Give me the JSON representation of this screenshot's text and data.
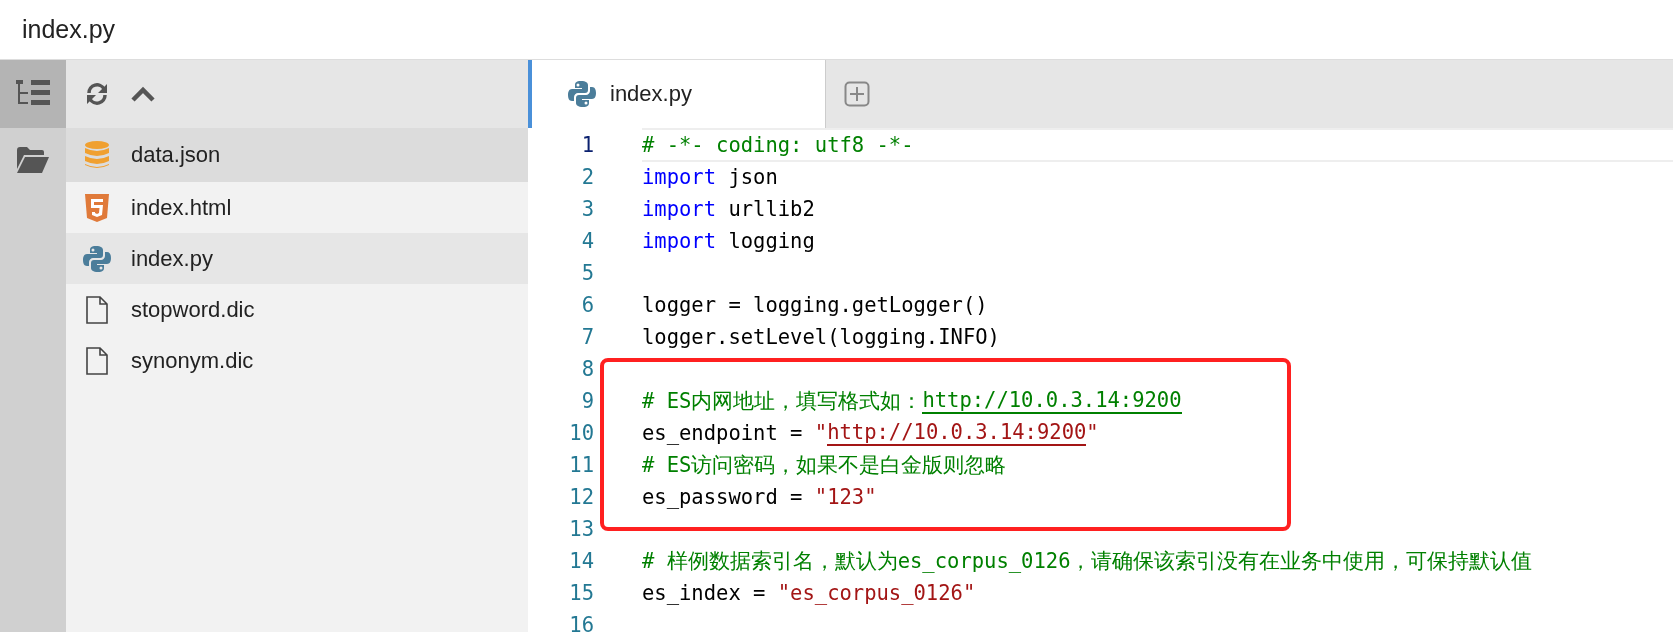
{
  "window": {
    "title": "index.py"
  },
  "sidebar": {
    "items": [
      {
        "label": "data.json",
        "kind": "database",
        "selected": true,
        "open": false
      },
      {
        "label": "index.html",
        "kind": "html5",
        "selected": false,
        "open": false
      },
      {
        "label": "index.py",
        "kind": "python",
        "selected": false,
        "open": true
      },
      {
        "label": "stopword.dic",
        "kind": "file",
        "selected": false,
        "open": false
      },
      {
        "label": "synonym.dic",
        "kind": "file",
        "selected": false,
        "open": false
      }
    ]
  },
  "tabs": [
    {
      "label": "index.py",
      "selected": true
    }
  ],
  "editor": {
    "lines": [
      {
        "number": "1",
        "active": true,
        "tokens": [
          {
            "kind": "comment",
            "text": "# -*- coding: utf8 -*-"
          }
        ]
      },
      {
        "number": "2",
        "active": false,
        "tokens": [
          {
            "kind": "keyword",
            "text": "import"
          },
          {
            "kind": "plain",
            "text": " json"
          }
        ]
      },
      {
        "number": "3",
        "active": false,
        "tokens": [
          {
            "kind": "keyword",
            "text": "import"
          },
          {
            "kind": "plain",
            "text": " urllib2"
          }
        ]
      },
      {
        "number": "4",
        "active": false,
        "tokens": [
          {
            "kind": "keyword",
            "text": "import"
          },
          {
            "kind": "plain",
            "text": " logging"
          }
        ]
      },
      {
        "number": "5",
        "active": false
      },
      {
        "number": "6",
        "active": false,
        "tokens": [
          {
            "kind": "plain",
            "text": "logger = logging.getLogger()"
          }
        ]
      },
      {
        "number": "7",
        "active": false,
        "tokens": [
          {
            "kind": "plain",
            "text": "logger.setLevel(logging.INFO)"
          }
        ]
      },
      {
        "number": "8",
        "active": false
      },
      {
        "number": "9",
        "active": false,
        "tokens": [
          {
            "kind": "comment",
            "text": "# ES内网地址，填写格式如："
          },
          {
            "kind": "comment-link",
            "text": "http://10.0.3.14:9200"
          }
        ]
      },
      {
        "number": "10",
        "active": false,
        "tokens": [
          {
            "kind": "plain",
            "text": "es_endpoint = "
          },
          {
            "kind": "string",
            "text": "\""
          },
          {
            "kind": "string-link",
            "text": "http://10.0.3.14:9200"
          },
          {
            "kind": "string",
            "text": "\""
          }
        ]
      },
      {
        "number": "11",
        "active": false,
        "tokens": [
          {
            "kind": "comment",
            "text": "# ES访问密码，如果不是白金版则忽略"
          }
        ]
      },
      {
        "number": "12",
        "active": false,
        "tokens": [
          {
            "kind": "plain",
            "text": "es_password = "
          },
          {
            "kind": "string",
            "text": "\"123\""
          }
        ]
      },
      {
        "number": "13",
        "active": false
      },
      {
        "number": "14",
        "active": false,
        "tokens": [
          {
            "kind": "comment",
            "text": "# 样例数据索引名，默认为es_corpus_0126，请确保该索引没有在业务中使用，可保持默认值"
          }
        ]
      },
      {
        "number": "15",
        "active": false,
        "tokens": [
          {
            "kind": "plain",
            "text": "es_index = "
          },
          {
            "kind": "string",
            "text": "\"es_corpus_0126\""
          }
        ]
      },
      {
        "number": "16",
        "active": false
      }
    ]
  }
}
